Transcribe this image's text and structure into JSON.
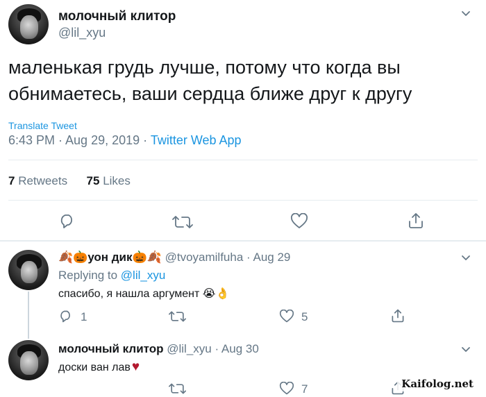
{
  "main_tweet": {
    "display_name": "молочный клитор",
    "handle": "@lil_xyu",
    "text_line1": "маленькая грудь лучше, потому что когда вы",
    "text_line2": "обнимаетесь, ваши сердца ближе друг к другу",
    "translate_label": "Translate Tweet",
    "timestamp": "6:43 PM · Aug 29, 2019 · ",
    "source": "Twitter Web App",
    "retweets_count": "7",
    "retweets_label": "Retweets",
    "likes_count": "75",
    "likes_label": "Likes"
  },
  "reply_1": {
    "display_name_prefix": "🍂🎃",
    "display_name_text": "уон дик",
    "display_name_suffix": "🎃🍂",
    "handle": "@tvoyamilfuha",
    "date": "· Aug 29",
    "replying_to_label": "Replying to ",
    "replying_to_handle": "@lil_xyu",
    "text": "спасибо, я нашла аргумент ",
    "text_emoji": "😭👌",
    "reply_count": "1",
    "like_count": "5"
  },
  "reply_2": {
    "display_name": "молочный клитор",
    "handle": "@lil_xyu",
    "date": "· Aug 30",
    "text": "доски ван лав",
    "text_emoji": "♥",
    "like_count": "7"
  },
  "watermark": "Kaifolog.net",
  "colors": {
    "link": "#1b95e0",
    "muted": "#657786",
    "divider": "#e6ecf0",
    "heart": "#b3192f"
  }
}
